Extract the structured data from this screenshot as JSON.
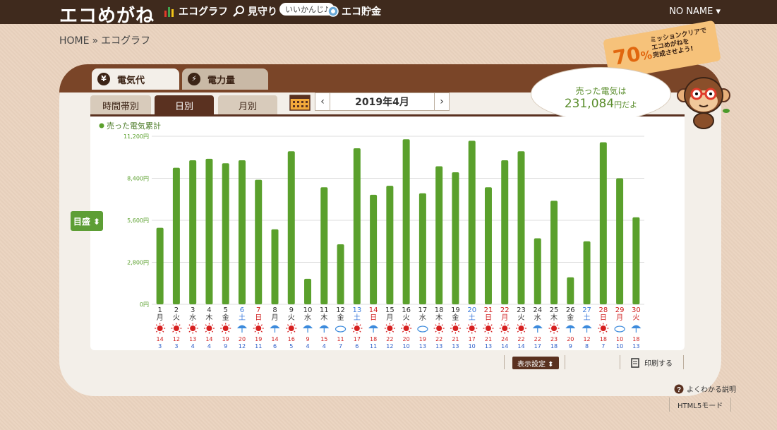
{
  "header": {
    "logo": "エコめがね",
    "nav": [
      {
        "label": "エコグラフ",
        "icon": "bar-graph-icon"
      },
      {
        "label": "見守り",
        "icon": "magnifier-icon"
      },
      {
        "label": "エコ貯金",
        "icon": "coin-icon"
      }
    ],
    "bubble": "いいかんじ♪",
    "user": "NO NAME ▾"
  },
  "breadcrumb": {
    "home": "HOME",
    "sep": "»",
    "current": "エコグラフ"
  },
  "mission": {
    "percent": "70",
    "unit": "%",
    "line1": "ミッションクリアで",
    "line2": "エコめがねを",
    "line3": "完成させよう!"
  },
  "tabs": {
    "main": [
      {
        "icon": "¥",
        "label": "電気代",
        "active": true
      },
      {
        "icon": "⚡",
        "label": "電力量",
        "active": false
      }
    ],
    "sub": [
      {
        "label": "時間帯別",
        "active": false
      },
      {
        "label": "日別",
        "active": true
      },
      {
        "label": "月別",
        "active": false
      }
    ]
  },
  "date_picker": {
    "prev": "‹",
    "value": "2019年4月",
    "next": "›"
  },
  "sold_total": {
    "label": "売った電気は",
    "value": "231,084",
    "unit": "円だよ"
  },
  "goal_button": "目盛 ⬍",
  "settings_button": "表示設定 ⬍",
  "print_label": "印刷する",
  "help_label": "よくわかる説明",
  "html5_label": "HTML5モード",
  "colors": {
    "bar": "#5aa02c",
    "sat": "#3d7bdc",
    "sun": "#d02020",
    "text": "#333333"
  },
  "chart_data": {
    "type": "bar",
    "legend": "売った電気累計",
    "y_ticks": [
      "11,200円",
      "8,400円",
      "5,600円",
      "2,800円",
      "0円"
    ],
    "ylim": [
      0,
      11200
    ],
    "days": [
      "1",
      "2",
      "3",
      "4",
      "5",
      "6",
      "7",
      "8",
      "9",
      "10",
      "11",
      "12",
      "13",
      "14",
      "15",
      "16",
      "17",
      "18",
      "19",
      "20",
      "21",
      "22",
      "23",
      "24",
      "25",
      "26",
      "27",
      "28",
      "29",
      "30"
    ],
    "weekdays": [
      "月",
      "火",
      "水",
      "木",
      "金",
      "土",
      "日",
      "月",
      "火",
      "水",
      "木",
      "金",
      "土",
      "日",
      "月",
      "火",
      "水",
      "木",
      "金",
      "土",
      "日",
      "月",
      "火",
      "水",
      "木",
      "金",
      "土",
      "日",
      "月",
      "火"
    ],
    "day_colors": [
      "n",
      "n",
      "n",
      "n",
      "n",
      "sat",
      "sun",
      "n",
      "n",
      "n",
      "n",
      "n",
      "sat",
      "sun",
      "n",
      "n",
      "n",
      "n",
      "n",
      "sat",
      "sun",
      "sun",
      "n",
      "n",
      "n",
      "n",
      "sat",
      "sun",
      "sun",
      "sun"
    ],
    "weather": [
      "sun",
      "sun",
      "sun",
      "sun",
      "sun",
      "rain",
      "sun",
      "rain",
      "sun",
      "rain",
      "rain",
      "cloud",
      "sun",
      "rain",
      "sun",
      "sun",
      "cloud",
      "sun",
      "sun",
      "sun",
      "sun",
      "sun",
      "sun",
      "rain",
      "sun",
      "rain",
      "rain",
      "sun",
      "cloud",
      "rain"
    ],
    "values": [
      5100,
      9100,
      9600,
      9700,
      9400,
      9600,
      8300,
      5000,
      10200,
      1700,
      7800,
      4000,
      10400,
      7300,
      7900,
      11000,
      7400,
      9200,
      8800,
      10900,
      7800,
      9600,
      10200,
      4400,
      6900,
      1800,
      4200,
      10800,
      8400,
      5800
    ],
    "temp_high": [
      "14",
      "12",
      "13",
      "14",
      "19",
      "20",
      "19",
      "14",
      "16",
      "9",
      "15",
      "11",
      "17",
      "18",
      "22",
      "20",
      "19",
      "22",
      "21",
      "17",
      "21",
      "24",
      "22",
      "22",
      "23",
      "20",
      "12",
      "18",
      "10",
      "18"
    ],
    "temp_low": [
      "3",
      "3",
      "4",
      "4",
      "9",
      "12",
      "11",
      "6",
      "5",
      "4",
      "4",
      "7",
      "6",
      "11",
      "12",
      "10",
      "13",
      "13",
      "13",
      "10",
      "13",
      "14",
      "14",
      "17",
      "18",
      "9",
      "8",
      "7",
      "10",
      "13"
    ]
  }
}
